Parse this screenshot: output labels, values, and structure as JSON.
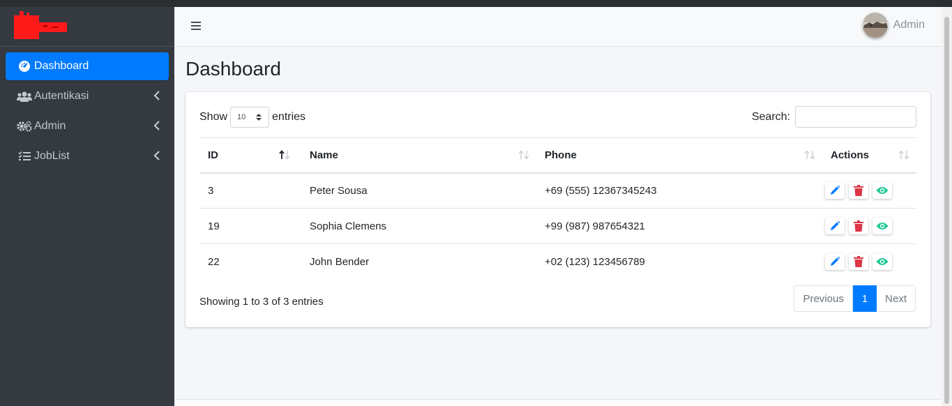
{
  "sidebar": {
    "items": [
      {
        "label": "Dashboard",
        "icon": "tachometer-icon",
        "active": true
      },
      {
        "label": "Autentikasi",
        "icon": "users-icon"
      },
      {
        "label": "Admin",
        "icon": "cogs-icon"
      },
      {
        "label": "JobList",
        "icon": "tasks-icon"
      }
    ]
  },
  "topbar": {
    "user_name": "Admin"
  },
  "page": {
    "title": "Dashboard"
  },
  "table_controls": {
    "show_label": "Show",
    "page_size": "10",
    "entries_label": "entries",
    "search_label": "Search:",
    "search_value": ""
  },
  "table": {
    "columns": [
      "ID",
      "Name",
      "Phone",
      "Actions"
    ],
    "rows": [
      {
        "id": "3",
        "name": "Peter Sousa",
        "phone": "+69 (555) 12367345243"
      },
      {
        "id": "19",
        "name": "Sophia Clemens",
        "phone": "+99 (987) 987654321"
      },
      {
        "id": "22",
        "name": "John Bender",
        "phone": "+02 (123) 123456789"
      }
    ]
  },
  "footer": {
    "info": "Showing 1 to 3 of 3 entries",
    "prev_label": "Previous",
    "page_label": "1",
    "next_label": "Next"
  },
  "colors": {
    "primary": "#007bff",
    "danger": "#dc3545",
    "success": "#20c997",
    "sidebar": "#343a40"
  }
}
